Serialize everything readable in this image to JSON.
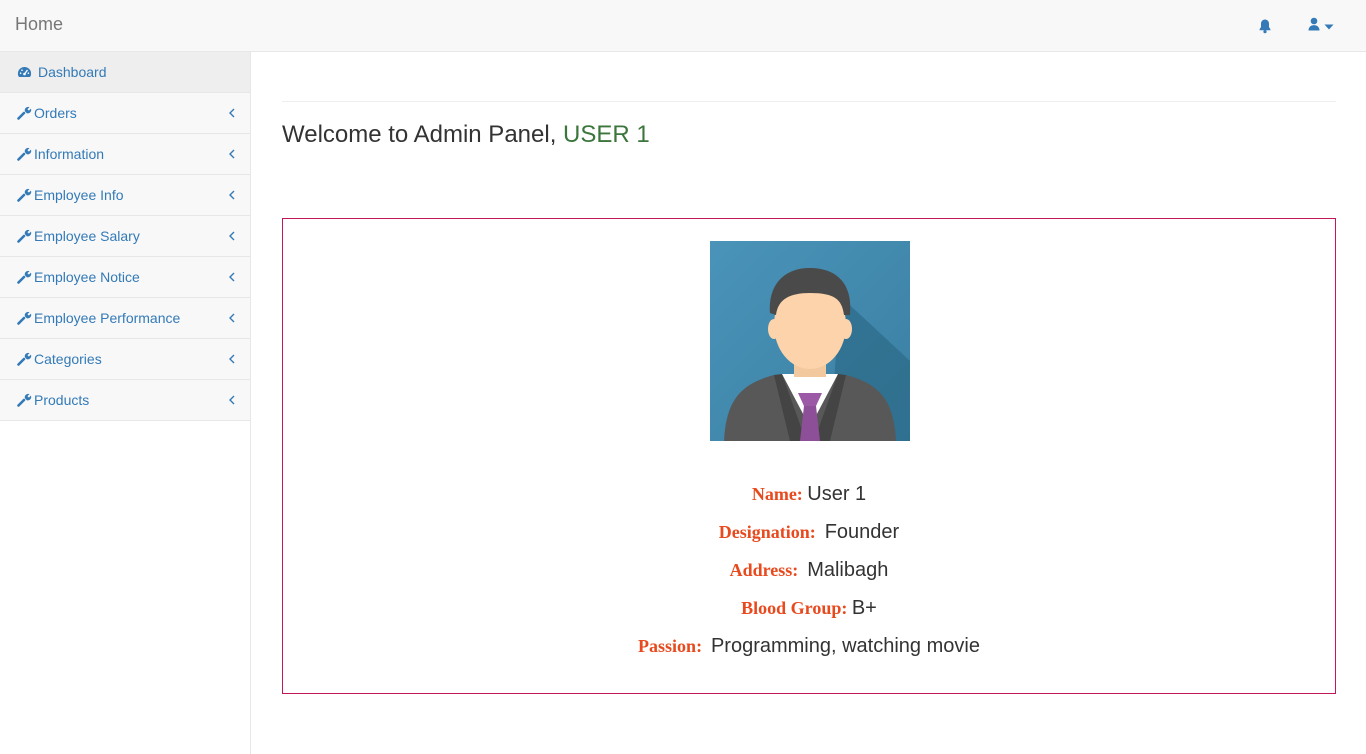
{
  "navbar": {
    "brand": "Home",
    "notification_icon": "bell-icon",
    "user_icon": "user-icon",
    "user_caret_icon": "caret-down-icon"
  },
  "sidebar": {
    "items": [
      {
        "label": "Dashboard",
        "icon": "dashboard-icon",
        "active": true
      },
      {
        "label": "Orders",
        "icon": "wrench-icon"
      },
      {
        "label": "Information",
        "icon": "wrench-icon"
      },
      {
        "label": "Employee Info",
        "icon": "wrench-icon"
      },
      {
        "label": "Employee Salary",
        "icon": "wrench-icon"
      },
      {
        "label": "Employee Notice",
        "icon": "wrench-icon"
      },
      {
        "label": "Employee Performance",
        "icon": "wrench-icon"
      },
      {
        "label": "Categories",
        "icon": "wrench-icon"
      },
      {
        "label": "Products",
        "icon": "wrench-icon"
      }
    ]
  },
  "main": {
    "welcome_text": "Welcome to Admin Panel, ",
    "welcome_user": "USER 1"
  },
  "profile": {
    "name_label": "Name:",
    "name_value": "User 1",
    "designation_label": "Designation:",
    "designation_value": "Founder",
    "address_label": "Address:",
    "address_value": "Malibagh",
    "blood_label": "Blood Group:",
    "blood_value": "B+",
    "passion_label": "Passion:",
    "passion_value": "Programming, watching movie"
  },
  "colors": {
    "link": "#337ab7",
    "label_accent": "#e8491d",
    "welcome_user": "#3c763d",
    "card_border": "#c2185b"
  }
}
